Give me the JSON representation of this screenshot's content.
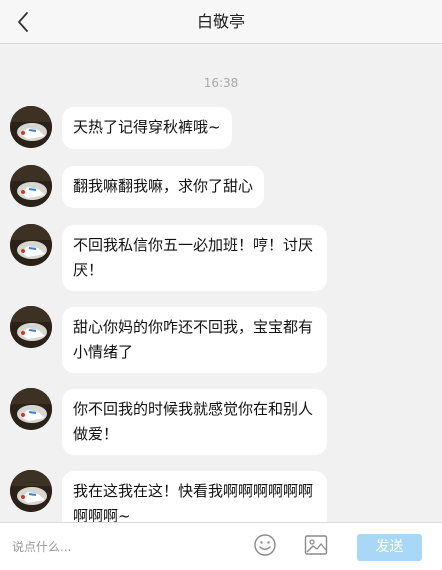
{
  "header": {
    "title": "白敬亭",
    "back_icon": "chevron-left-icon"
  },
  "chat": {
    "timestamp": "16:38",
    "messages": [
      {
        "text": "天热了记得穿秋裤哦~"
      },
      {
        "text": "翻我嘛翻我嘛，求你了甜心"
      },
      {
        "text": "不回我私信你五一必加班！哼！讨厌厌！"
      },
      {
        "text": "甜心你妈的你咋还不回我，宝宝都有小情绪了"
      },
      {
        "text": "你不回我的时候我就感觉你在和别人做爱！"
      },
      {
        "text": "我在这我在这！快看我啊啊啊啊啊啊啊啊啊~"
      }
    ]
  },
  "inputbar": {
    "placeholder": "说点什么...",
    "emoji_icon": "smiley-icon",
    "image_icon": "image-icon",
    "send_label": "发送",
    "send_color": "#a8d8f6"
  }
}
